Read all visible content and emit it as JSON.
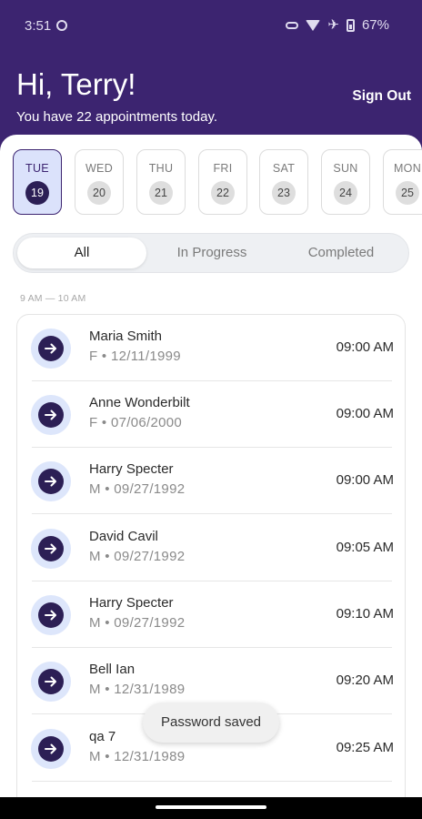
{
  "status_bar": {
    "time": "3:51",
    "battery": "67%"
  },
  "header": {
    "greeting": "Hi, Terry!",
    "subtitle": "You have 22 appointments today.",
    "sign_out_label": "Sign Out"
  },
  "days": [
    {
      "name": "TUE",
      "num": "19",
      "selected": true
    },
    {
      "name": "WED",
      "num": "20",
      "selected": false
    },
    {
      "name": "THU",
      "num": "21",
      "selected": false
    },
    {
      "name": "FRI",
      "num": "22",
      "selected": false
    },
    {
      "name": "SAT",
      "num": "23",
      "selected": false
    },
    {
      "name": "SUN",
      "num": "24",
      "selected": false
    },
    {
      "name": "MON",
      "num": "25",
      "selected": false
    }
  ],
  "filters": {
    "all": "All",
    "in_progress": "In Progress",
    "completed": "Completed",
    "active": "all"
  },
  "time_range": "9 AM — 10 AM",
  "appointments": [
    {
      "name": "Maria Smith",
      "meta": "F • 12/11/1999",
      "time": "09:00 AM"
    },
    {
      "name": "Anne Wonderbilt",
      "meta": "F • 07/06/2000",
      "time": "09:00 AM"
    },
    {
      "name": "Harry Specter",
      "meta": "M • 09/27/1992",
      "time": "09:00 AM"
    },
    {
      "name": "David Cavil",
      "meta": "M • 09/27/1992",
      "time": "09:05 AM"
    },
    {
      "name": "Harry Specter",
      "meta": "M • 09/27/1992",
      "time": "09:10 AM"
    },
    {
      "name": "Bell Ian",
      "meta": "M • 12/31/1989",
      "time": "09:20 AM"
    },
    {
      "name": "qa 7",
      "meta": "M • 12/31/1989",
      "time": "09:25 AM"
    }
  ],
  "toast": "Password saved",
  "colors": {
    "brand": "#3c2470",
    "accent_dark": "#2c1f55",
    "selected_bg": "#dbe2fb"
  }
}
